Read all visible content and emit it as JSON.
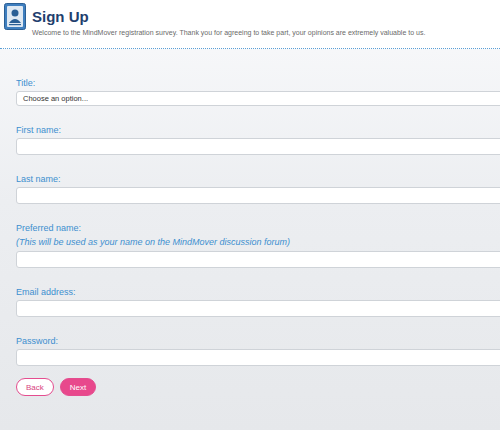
{
  "header": {
    "title": "Sign Up",
    "subtitle": "Welcome to the MindMover registration survey. Thank you for agreeing to take part, your opinions are extremely valuable to us."
  },
  "fields": [
    {
      "label": "Title:",
      "kind": "select",
      "placeholder": "Choose an option..."
    },
    {
      "label": "First name:",
      "kind": "text"
    },
    {
      "label": "Last name:",
      "kind": "text"
    },
    {
      "label": "Preferred name:",
      "note": "(This will be used as your name on the MindMover discussion forum)",
      "kind": "text"
    },
    {
      "label": "Email address:",
      "kind": "text"
    },
    {
      "label": "Password:",
      "kind": "password"
    }
  ],
  "buttons": [
    {
      "label": "Back",
      "kind": "secondary"
    },
    {
      "label": "Next",
      "kind": "primary"
    }
  ]
}
